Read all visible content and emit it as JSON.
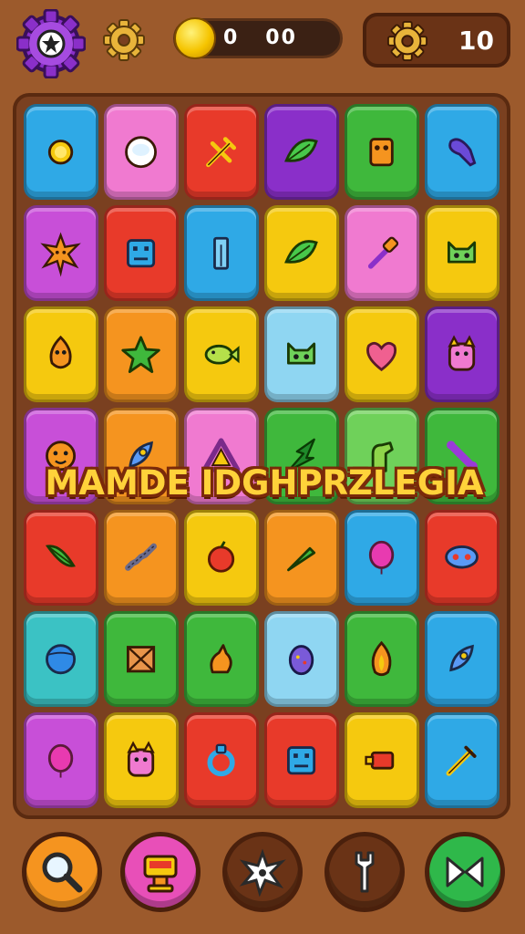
{
  "header": {
    "coin_text": "0   00",
    "level_number": "10"
  },
  "banner": {
    "text": "MAMDE IDGHPRZLEGIA"
  },
  "colors": {
    "background": "#9c5a2c",
    "board": "#7a4020",
    "banner_text": "#ffd23a"
  },
  "board": {
    "rows": [
      [
        "blue:sun-icon",
        "pink:plate-icon",
        "red:tool-icon",
        "purple:leaf-icon",
        "green:robot-icon",
        "blue:bottle-icon"
      ],
      [
        "magenta:star-burst-icon",
        "red:robot-box-icon",
        "blue:pillar-icon",
        "yellow:leaf-icon",
        "pink:brush-icon",
        "yellow:cat-face-icon"
      ],
      [
        "yellow:fox-icon",
        "orange:star-icon",
        "yellow:fish-icon",
        "lblue:cat-face-icon",
        "yellow:heart-icon",
        "purple:cat-icon"
      ],
      [
        "magenta:face-icon",
        "orange:rocket-icon",
        "pink:triangle-icon",
        "green:arrow-icon",
        "lgreen:glove-icon",
        "green:bone-icon"
      ],
      [
        "red:feather-icon",
        "orange:spring-icon",
        "yellow:apple-icon",
        "orange:carrot-icon",
        "blue:balloon-icon",
        "red:mask-icon"
      ],
      [
        "teal:ball-icon",
        "green:box-icon",
        "green:bird-icon",
        "lblue:egg-icon",
        "green:flame-icon",
        "blue:rocket-icon"
      ],
      [
        "magenta:balloon-icon",
        "yellow:cat-icon",
        "red:ring-icon",
        "red:robot-box-icon",
        "yellow:cannon-icon",
        "blue:sword-icon"
      ]
    ]
  },
  "bottom_buttons": [
    {
      "name": "search-button",
      "icon": "magnifier-icon",
      "color": "#f5941f"
    },
    {
      "name": "shop-button",
      "icon": "stand-icon",
      "color": "#e84fb8"
    },
    {
      "name": "powerup-button",
      "icon": "star-burst-icon",
      "color": "#6a3316"
    },
    {
      "name": "tool-button",
      "icon": "wrench-icon",
      "color": "#6a3316"
    },
    {
      "name": "next-button",
      "icon": "bow-icon",
      "color": "#2fb84a"
    }
  ]
}
